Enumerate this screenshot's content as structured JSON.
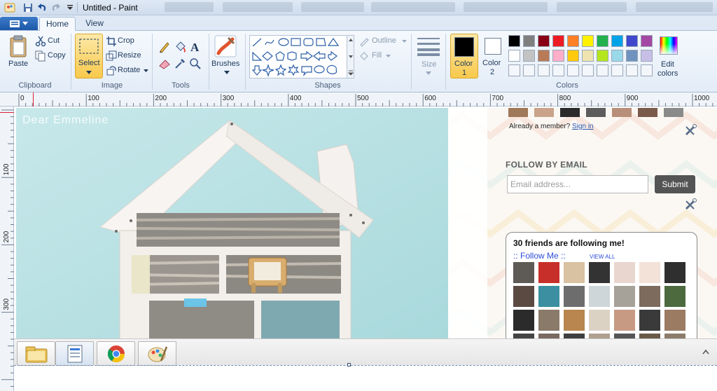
{
  "window": {
    "title": "Untitled - Paint"
  },
  "ribbon": {
    "tabs": [
      "Home",
      "View"
    ],
    "clipboard": {
      "paste": "Paste",
      "cut": "Cut",
      "copy": "Copy",
      "group": "Clipboard"
    },
    "image": {
      "select": "Select",
      "crop": "Crop",
      "resize": "Resize",
      "rotate": "Rotate",
      "group": "Image"
    },
    "tools": {
      "group": "Tools"
    },
    "brushes": "Brushes",
    "shapes": {
      "outline": "Outline",
      "fill": "Fill",
      "group": "Shapes"
    },
    "size": "Size",
    "color1": {
      "line1": "Color",
      "line2": "1",
      "value": "#000000"
    },
    "color2": {
      "line1": "Color",
      "line2": "2",
      "value": "#ffffff"
    },
    "edit_colors": {
      "line1": "Edit",
      "line2": "colors"
    },
    "colors_group": "Colors",
    "palette_row1": [
      "#000000",
      "#7f7f7f",
      "#880015",
      "#ed1c24",
      "#ff7f27",
      "#fff200",
      "#22b14c",
      "#00a2e8",
      "#3f48cc",
      "#a349a4"
    ],
    "palette_row2": [
      "#ffffff",
      "#c3c3c3",
      "#b97a57",
      "#ffaec9",
      "#ffc90e",
      "#efe4b0",
      "#b5e61d",
      "#99d9ea",
      "#7092be",
      "#c8bfe7"
    ]
  },
  "ruler": {
    "h_ticks": [
      "0",
      "100",
      "200",
      "300",
      "400",
      "500",
      "600",
      "700",
      "800",
      "900",
      "1000"
    ],
    "v_ticks": [
      "100",
      "200",
      "300"
    ]
  },
  "pasted_image": {
    "photo_watermark": "Dear Emmeline",
    "already_member": "Already a member?",
    "sign_in": "Sign in",
    "follow_by_email": "FOLLOW BY EMAIL",
    "email_placeholder": "Email address...",
    "submit": "Submit",
    "followers_heading": "30 friends are following me!",
    "follow_me": ":: Follow Me ::",
    "view_all": "VIEW ALL"
  },
  "taskbar": {
    "items": [
      "folder-icon",
      "document-icon",
      "chrome-icon",
      "paint-icon"
    ]
  }
}
